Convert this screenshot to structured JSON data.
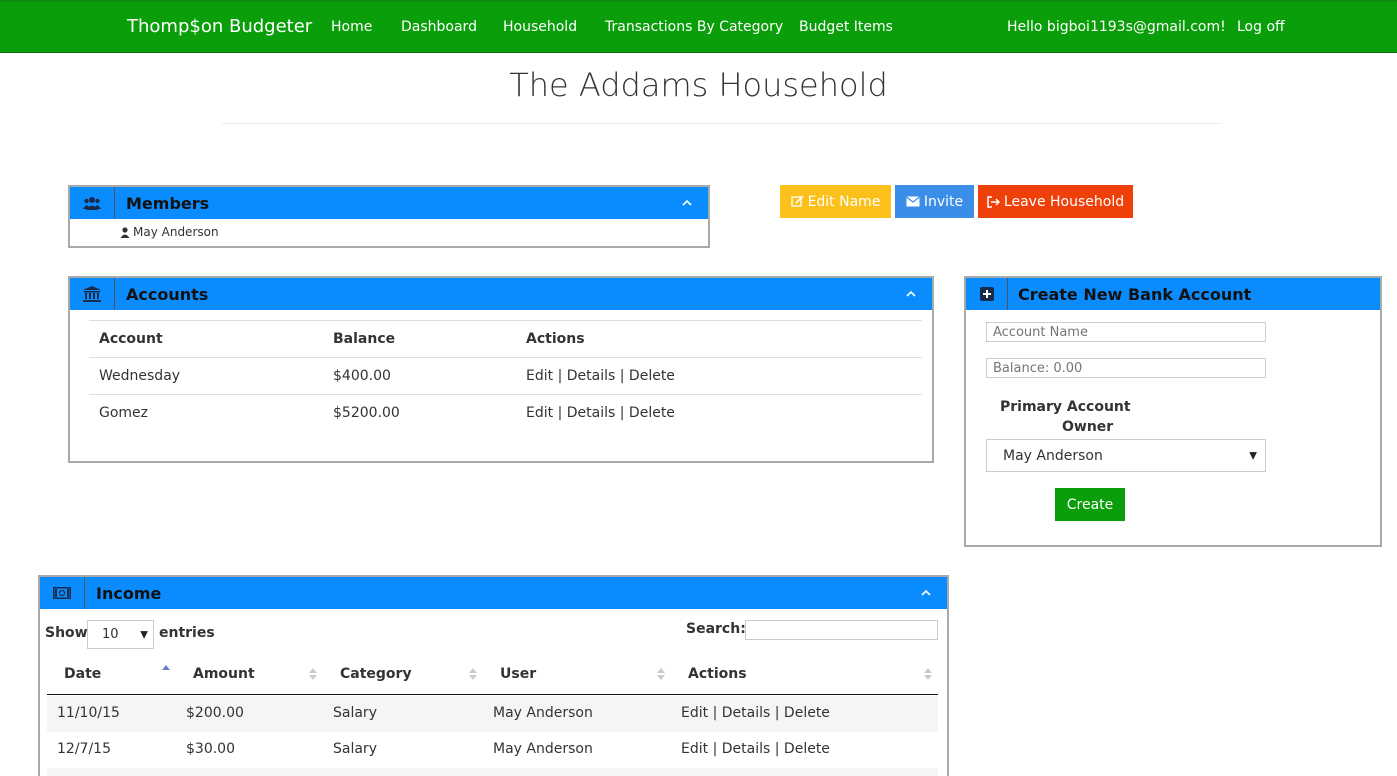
{
  "navbar": {
    "brand": "Thomp$on Budgeter",
    "links": [
      "Home",
      "Dashboard",
      "Household",
      "Transactions By Category",
      "Budget Items"
    ],
    "greeting": "Hello bigboi1193s@gmail.com!",
    "logoff": "Log off"
  },
  "page": {
    "title": "The Addams Household"
  },
  "members": {
    "title": "Members",
    "list": [
      "May Anderson"
    ]
  },
  "actions": {
    "edit_name": "Edit Name",
    "invite": "Invite",
    "leave": "Leave Household"
  },
  "accounts": {
    "title": "Accounts",
    "headers": [
      "Account",
      "Balance",
      "Actions"
    ],
    "rows": [
      {
        "account": "Wednesday",
        "balance": "$400.00"
      },
      {
        "account": "Gomez",
        "balance": "$5200.00"
      }
    ],
    "links": {
      "edit": "Edit",
      "details": "Details",
      "delete": "Delete",
      "sep": "|"
    }
  },
  "create_account": {
    "title": "Create New Bank Account",
    "name_placeholder": "Account Name",
    "balance_placeholder": "Balance: 0.00",
    "owner_label_1": "Primary Account",
    "owner_label_2": "Owner",
    "owner_selected": "May Anderson",
    "create_label": "Create"
  },
  "income": {
    "title": "Income",
    "show_label": "Show",
    "entries_value": "10",
    "entries_label": "entries",
    "search_label": "Search:",
    "headers": [
      "Date",
      "Amount",
      "Category",
      "User",
      "Actions"
    ],
    "rows": [
      {
        "date": "11/10/15",
        "amount": "$200.00",
        "category": "Salary",
        "user": "May Anderson"
      },
      {
        "date": "12/7/15",
        "amount": "$30.00",
        "category": "Salary",
        "user": "May Anderson"
      }
    ]
  },
  "colors": {
    "navbar": "#0a9f0a",
    "panel_header": "#0a8cff",
    "warning": "#fcc01b",
    "info": "#3a8ee8",
    "danger": "#f0400a",
    "success": "#0a9f0a"
  }
}
